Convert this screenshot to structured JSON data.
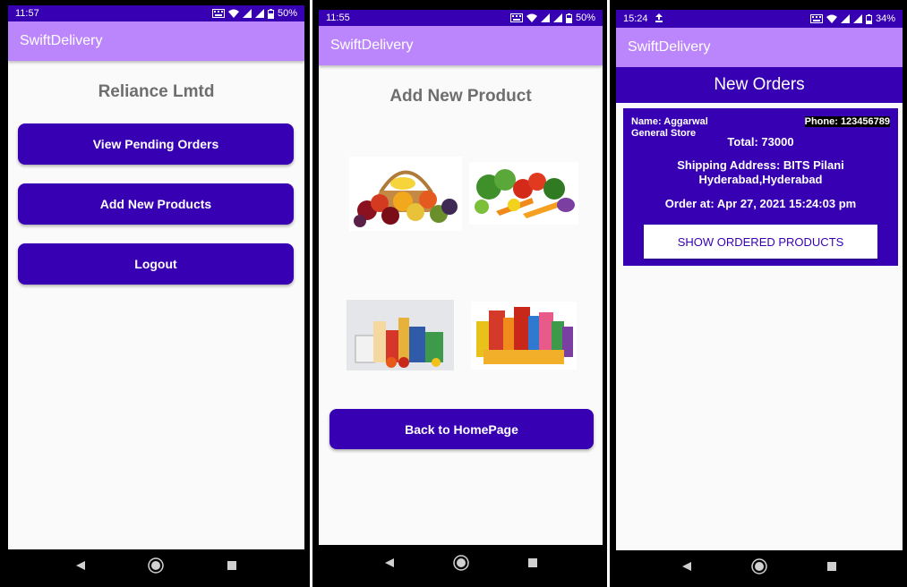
{
  "screens": [
    {
      "status": {
        "time": "11:57",
        "battery": "50%"
      },
      "app_title": "SwiftDelivery",
      "store_name": "Reliance Lmtd",
      "buttons": {
        "pending": "View Pending Orders",
        "add": "Add New Products",
        "logout": "Logout"
      }
    },
    {
      "status": {
        "time": "11:55",
        "battery": "50%"
      },
      "app_title": "SwiftDelivery",
      "page_title": "Add New Product",
      "categories": [
        "fruits-image",
        "vegetables-image",
        "groceries-image",
        "packaged-products-image"
      ],
      "back_button": "Back to HomePage"
    },
    {
      "status": {
        "time": "15:24",
        "battery": "34%"
      },
      "app_title": "SwiftDelivery",
      "header": "New Orders",
      "order": {
        "name_line1": "Name: Aggarwal",
        "name_line2": "General Store",
        "phone": "Phone: 123456789",
        "total": "Total: 73000",
        "address_line1": "Shipping Address: BITS Pilani",
        "address_line2": "Hyderabad,Hyderabad",
        "order_at": "Order at: Apr 27, 2021 15:24:03 pm",
        "show_button": "SHOW ORDERED PRODUCTS"
      }
    }
  ],
  "colors": {
    "primary": "#3700b3",
    "appbar": "#bb86fc",
    "background": "#fafafa"
  },
  "icons": [
    "keyboard-icon",
    "wifi-icon",
    "signal-icon",
    "battery-icon",
    "upload-icon",
    "back-nav-icon",
    "home-nav-icon",
    "recents-nav-icon"
  ]
}
